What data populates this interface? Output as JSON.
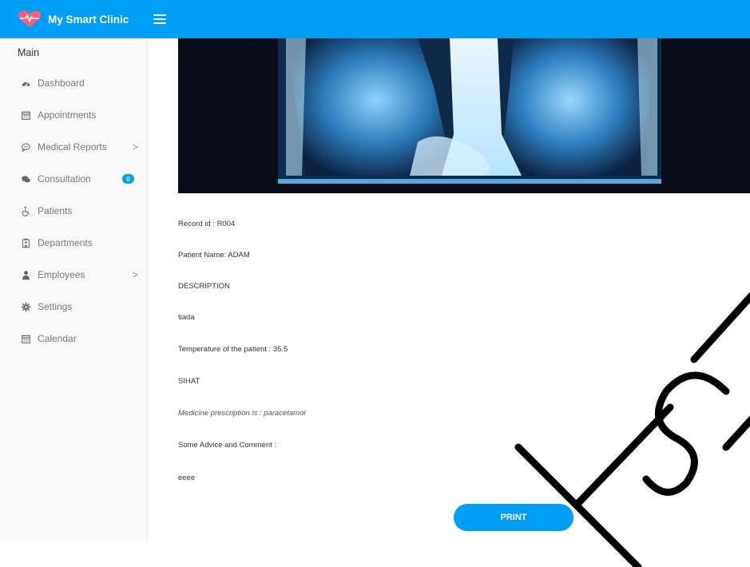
{
  "app": {
    "name": "My Smart Clinic",
    "accent": "#009ef5",
    "logo_icon": "heart-pulse-icon",
    "menu_icon": "hamburger-icon"
  },
  "sidebar": {
    "heading": "Main",
    "items": [
      {
        "label": "Dashboard",
        "icon": "dashboard-icon"
      },
      {
        "label": "Appointments",
        "icon": "calendar-icon"
      },
      {
        "label": "Medical Reports",
        "icon": "comment-icon",
        "chevron": ">"
      },
      {
        "label": "Consultation",
        "icon": "comments-icon",
        "badge": "0"
      },
      {
        "label": "Patients",
        "icon": "wheelchair-icon"
      },
      {
        "label": "Departments",
        "icon": "hospital-icon"
      },
      {
        "label": "Employees",
        "icon": "user-icon",
        "chevron": ">"
      },
      {
        "label": "Settings",
        "icon": "cog-icon"
      },
      {
        "label": "Calendar",
        "icon": "calendar-icon"
      }
    ]
  },
  "record": {
    "image_alt": "chest-xray-image",
    "record_id": "Record id : R004",
    "patient_name": "Patient Name: ADAM",
    "description_heading": "DESCRIPTION",
    "description": "tiada",
    "temperature": "Temperature of the patient : 35.5",
    "status": "SIHAT",
    "prescription": "Medicine prescription is : paracetamol",
    "advice_heading": "Some Advice and Comment :",
    "advice": "eeee"
  },
  "actions": {
    "print_label": "PRINT"
  }
}
